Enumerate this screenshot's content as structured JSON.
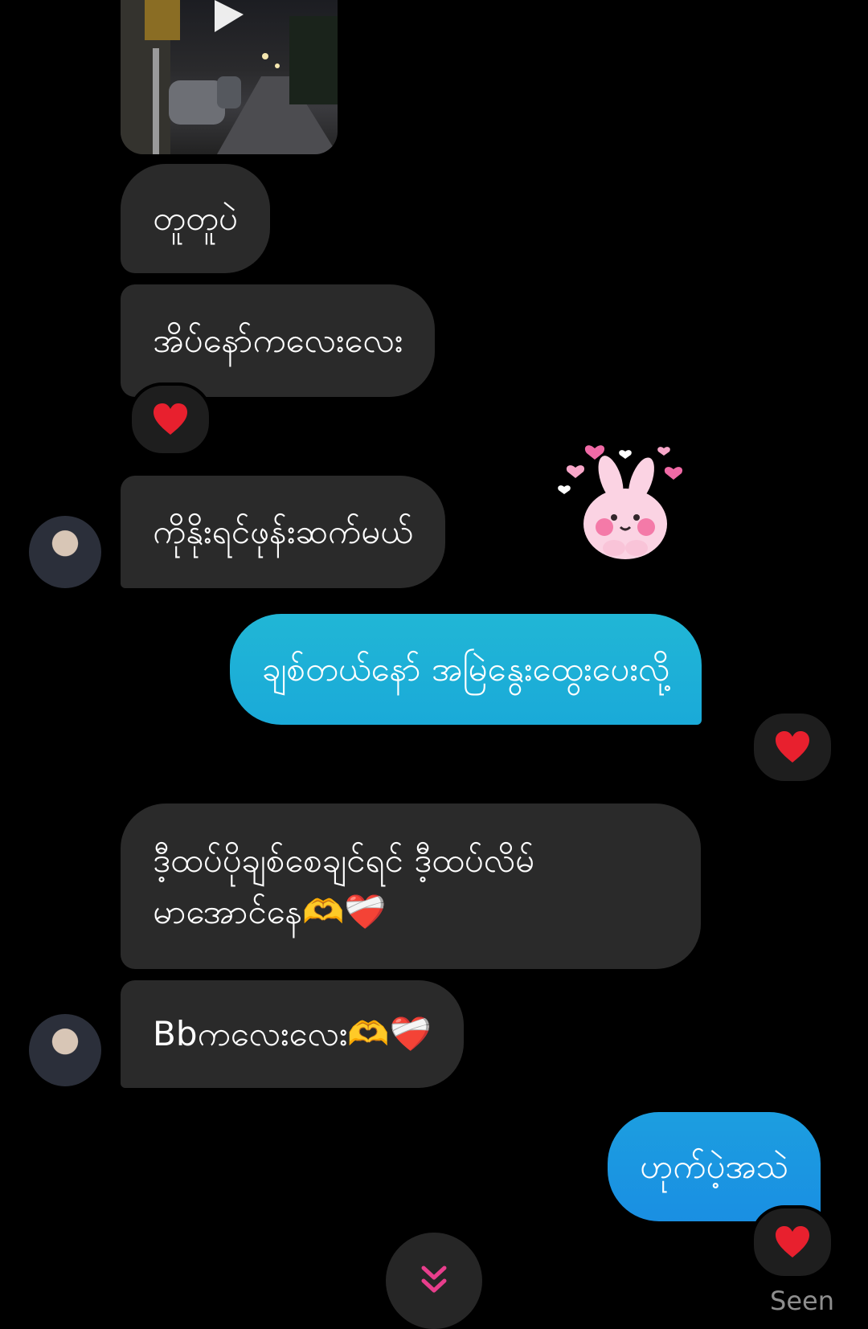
{
  "messages": {
    "m1": "တူတူပဲ",
    "m2": "အိပ်နော်ကလေးလေး",
    "m3": "ကိုနိုးရင်ဖုန်းဆက်မယ်",
    "m4": "ချစ်တယ်နော် အမြဲနွေးထွေးပေးလို့",
    "m5_line1": "ဒီ့ထပ်ပိုချစ်စေချင်ရင် ဒီ့ထပ်လိမ်",
    "m5_line2": "မာအောင်နေ🫶❤️‍🩹",
    "m6": "Bbကလေးလေး🫶❤️‍🩹",
    "m7": "ဟုက်ပဲ့အသဲ"
  },
  "status": {
    "seen": "Seen"
  },
  "icons": {
    "reaction": "heart-icon",
    "scroll": "double-chevron-down-icon",
    "sticker": "bunny-hearts-sticker",
    "video_play": "play-icon"
  },
  "colors": {
    "incoming_bubble": "#2a2a2a",
    "outgoing_top": "#1fb0d6",
    "outgoing_bottom": "#1a94e0",
    "heart": "#e8202e",
    "accent_pink": "#e83e8c"
  }
}
